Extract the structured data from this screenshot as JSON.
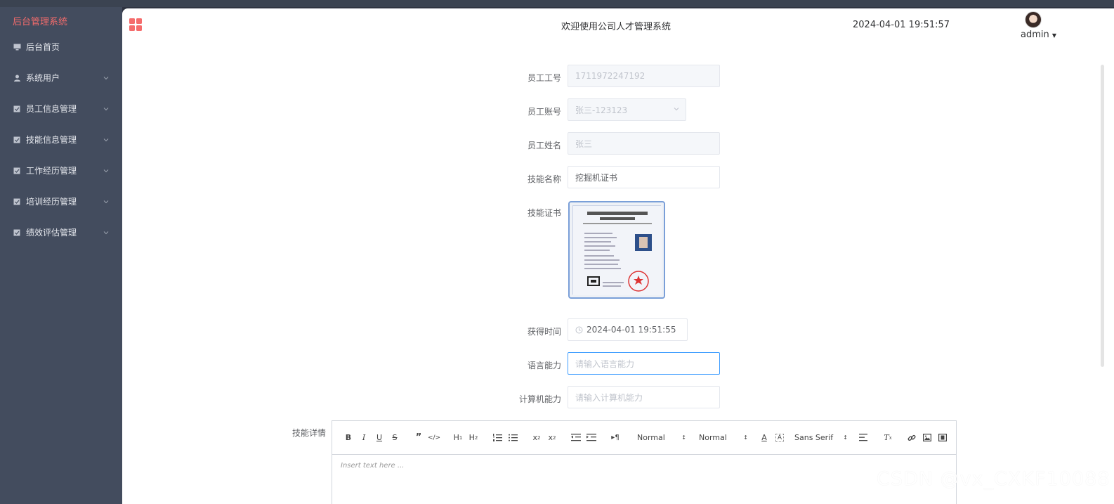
{
  "sidebar": {
    "brand": "后台管理系统",
    "items": [
      {
        "label": "后台首页",
        "icon": "monitor-icon",
        "expandable": false
      },
      {
        "label": "系统用户",
        "icon": "user-icon",
        "expandable": true
      },
      {
        "label": "员工信息管理",
        "icon": "checkbox-icon",
        "expandable": true
      },
      {
        "label": "技能信息管理",
        "icon": "checkbox-icon",
        "expandable": true
      },
      {
        "label": "工作经历管理",
        "icon": "checkbox-icon",
        "expandable": true
      },
      {
        "label": "培训经历管理",
        "icon": "checkbox-icon",
        "expandable": true
      },
      {
        "label": "绩效评估管理",
        "icon": "checkbox-icon",
        "expandable": true
      }
    ]
  },
  "header": {
    "welcome": "欢迎使用公司人才管理系统",
    "datetime": "2024-04-01 19:51:57",
    "username": "admin"
  },
  "form": {
    "employee_id": {
      "label": "员工工号",
      "value": "1711972247192"
    },
    "employee_account": {
      "label": "员工账号",
      "value": "张三-123123"
    },
    "employee_name": {
      "label": "员工姓名",
      "value": "张三"
    },
    "skill_name": {
      "label": "技能名称",
      "value": "挖掘机证书"
    },
    "skill_cert": {
      "label": "技能证书"
    },
    "obtained_time": {
      "label": "获得时间",
      "value": "2024-04-01 19:51:55"
    },
    "language": {
      "label": "语言能力",
      "placeholder": "请输入语言能力"
    },
    "computer": {
      "label": "计算机能力",
      "placeholder": "请输入计算机能力"
    },
    "skill_detail": {
      "label": "技能详情"
    }
  },
  "editor": {
    "header_select": "Normal",
    "size_select": "Normal",
    "font_select": "Sans Serif",
    "placeholder": "Insert text here ..."
  },
  "colors": {
    "sidebar_bg": "#434c5e",
    "brand": "#f56c6c",
    "focus": "#409eff",
    "grid_icon": "#f56c6c"
  },
  "watermark": "CSDN @vx_CXKF10088"
}
